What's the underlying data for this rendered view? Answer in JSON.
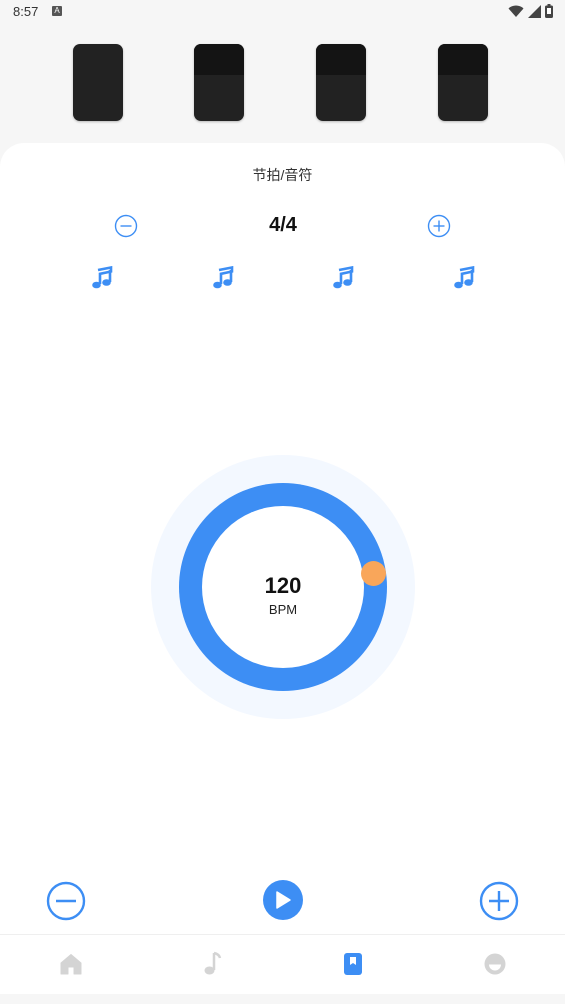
{
  "status_bar": {
    "time": "8:57",
    "notification_glyph": "A",
    "icons": [
      "wifi-icon",
      "signal-icon",
      "battery-icon"
    ]
  },
  "beat_blocks": [
    {
      "name": "beat-block-1",
      "accent": true
    },
    {
      "name": "beat-block-2",
      "accent": false
    },
    {
      "name": "beat-block-3",
      "accent": false
    },
    {
      "name": "beat-block-4",
      "accent": false
    }
  ],
  "settings": {
    "title": "节拍/音符",
    "time_signature": "4/4",
    "note_icons": [
      "music-note-icon",
      "music-note-icon",
      "music-note-icon",
      "music-note-icon"
    ]
  },
  "dial": {
    "bpm": "120",
    "unit": "BPM"
  },
  "controls": {
    "minus_icon": "minus-circle-icon",
    "play_icon": "play-icon",
    "plus_icon": "plus-circle-icon"
  },
  "nav": {
    "items": [
      {
        "icon": "home-icon",
        "active": false
      },
      {
        "icon": "music-note-icon",
        "active": false
      },
      {
        "icon": "bookmark-icon",
        "active": true
      },
      {
        "icon": "profile-icon",
        "active": false
      }
    ]
  },
  "colors": {
    "accent": "#3d8ef4",
    "knob": "#f9a65a",
    "block": "#222222",
    "inactive_nav": "#d4d4d4"
  }
}
